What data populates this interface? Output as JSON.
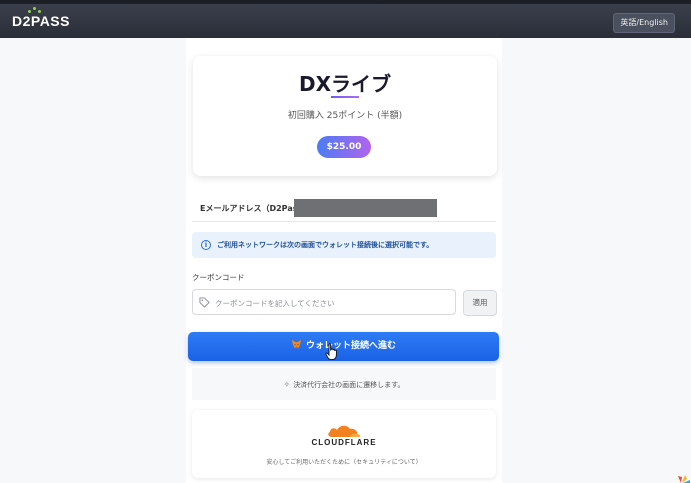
{
  "header": {
    "logo_text": "D2PASS",
    "lang_button": "英語/English"
  },
  "product": {
    "title": "DXライブ",
    "subtitle": "初回購入 25ポイント (半額)",
    "price": "$25.00"
  },
  "email": {
    "label": "Eメールアドレス（D2Pass ID"
  },
  "info": {
    "icon": "info-icon",
    "text": "ご利用ネットワークは次の画面でウォレット接続後に選択可能です。"
  },
  "coupon": {
    "label": "クーポンコード",
    "placeholder": "クーポンコードを記入してください",
    "value": "",
    "apply_label": "適用"
  },
  "connect": {
    "label": "ウォレット接続へ進む",
    "icon": "metamask-fox-icon"
  },
  "note": {
    "text": "決済代行会社の画面に遷移します。"
  },
  "cloudflare": {
    "logo_text": "CLOUDFLARE",
    "text": "安心してご利用いただくために（セキュリティについて）"
  },
  "colors": {
    "topbar": "#2f333e",
    "accent_blue": "#1f6cf0",
    "price_gradient_start": "#4c7cf5",
    "price_gradient_end": "#b063ee",
    "cloudflare_orange": "#f48120"
  }
}
